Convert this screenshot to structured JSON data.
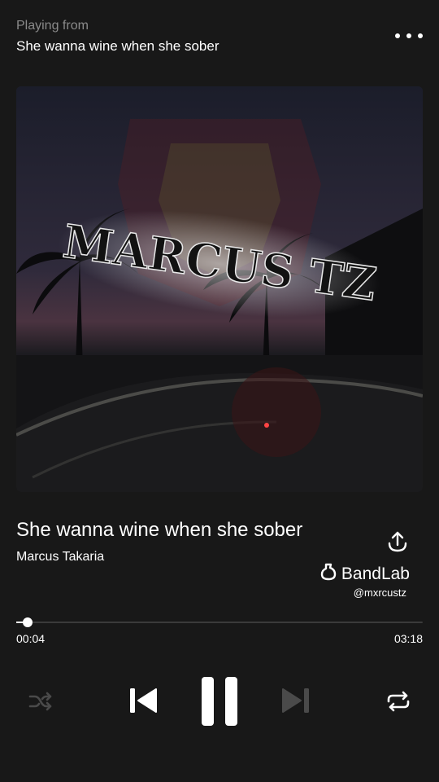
{
  "header": {
    "playing_from_label": "Playing from",
    "source_name": "She wanna wine when she sober",
    "more_icon": "more-horizontal-icon"
  },
  "artwork": {
    "logo_text": "MARCUS TZ"
  },
  "track": {
    "title": "She wanna wine when she sober",
    "artist": "Marcus Takaria"
  },
  "brand": {
    "name": "BandLab",
    "handle": "@mxrcustz"
  },
  "playback": {
    "elapsed": "00:04",
    "total": "03:18",
    "progress_fraction": 0.02
  },
  "controls": {
    "shuffle_icon": "shuffle-icon",
    "previous_icon": "skip-previous-icon",
    "pause_icon": "pause-icon",
    "next_icon": "skip-next-icon",
    "repeat_icon": "repeat-icon"
  },
  "colors": {
    "background": "#181818",
    "text_primary": "#ffffff",
    "text_secondary": "#8a8a8a",
    "disabled_icon": "#4a4a4a"
  }
}
